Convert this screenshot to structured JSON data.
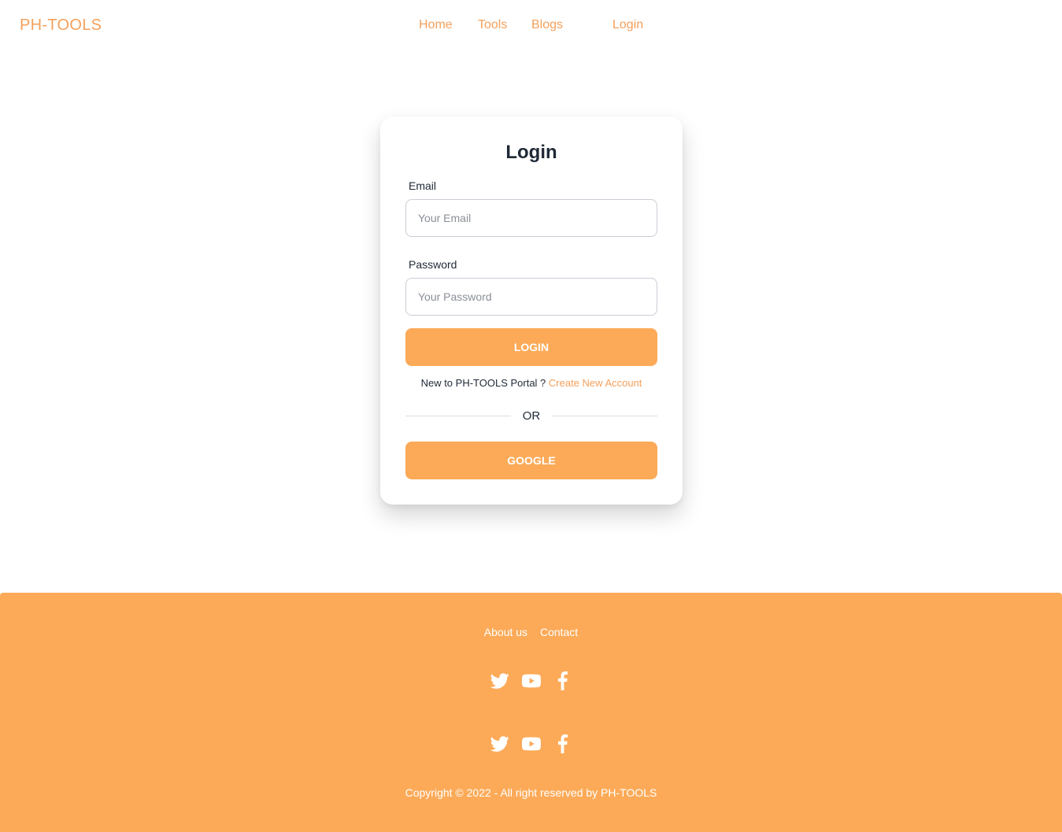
{
  "nav": {
    "brand": "PH-TOOLS",
    "links": [
      "Home",
      "Tools",
      "Blogs",
      "Login"
    ]
  },
  "login_form": {
    "title": "Login",
    "email_label": "Email",
    "email_placeholder": "Your Email",
    "password_label": "Password",
    "password_placeholder": "Your Password",
    "login_button": "LOGIN",
    "signup_prompt": "New to PH-TOOLS Portal ? ",
    "signup_link": "Create New Account",
    "divider": "OR",
    "google_button": "GOOGLE"
  },
  "footer": {
    "links": [
      "About us",
      "Contact"
    ],
    "social_icons": [
      "twitter-icon",
      "youtube-icon",
      "facebook-icon"
    ],
    "copyright": "Copyright © 2022 - All right reserved by PH-TOOLS"
  },
  "colors": {
    "accent": "#fcaa58",
    "accent_text": "#f5a05b",
    "text": "#1f2937",
    "footer_text": "#ffffff"
  }
}
